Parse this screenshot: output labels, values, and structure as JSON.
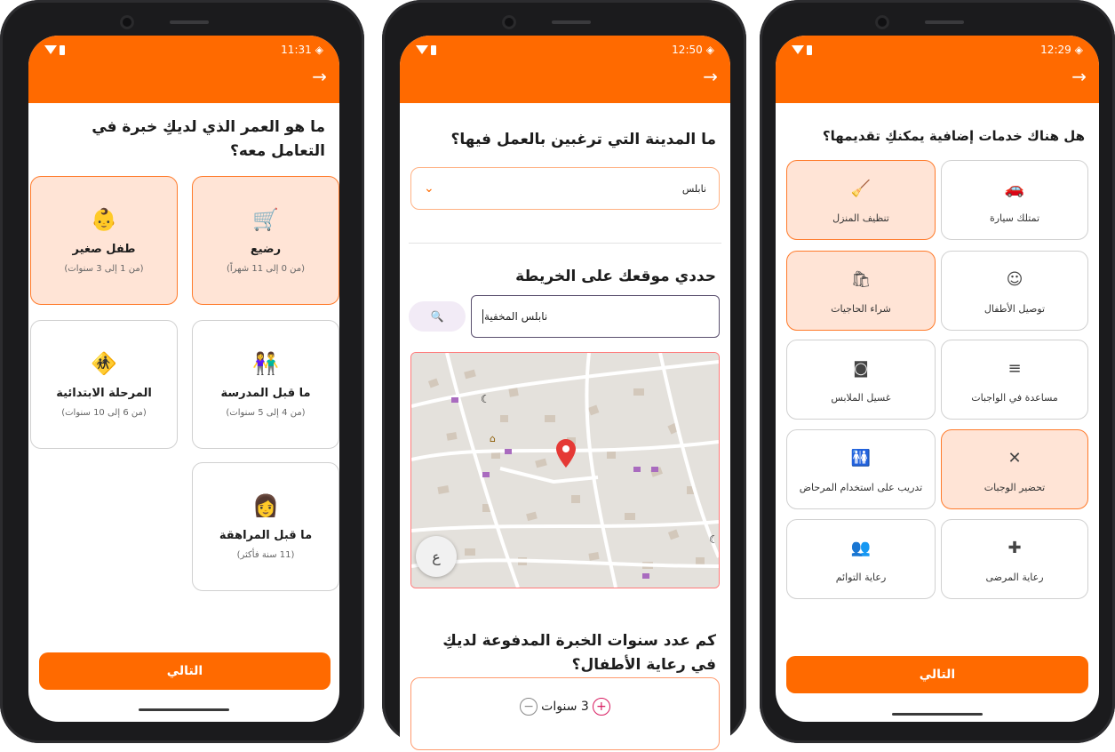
{
  "phone1": {
    "status": {
      "time": "11:31"
    },
    "question": "ما هو العمر الذي لديكِ خبرة في التعامل معه؟",
    "cards": [
      {
        "name": "رضيع",
        "sub": "(من 0 إلى 11 شهراً)",
        "icon": "baby-stroller-icon",
        "selected": true
      },
      {
        "name": "طفل صغير",
        "sub": "(من 1 إلى 3 سنوات)",
        "icon": "crawling-baby-icon",
        "selected": true
      },
      {
        "name": "ما قبل المدرسة",
        "sub": "(من 4 إلى 5 سنوات)",
        "icon": "kids-icon",
        "selected": false
      },
      {
        "name": "المرحلة الابتدائية",
        "sub": "(من 6 إلى 10 سنوات)",
        "icon": "school-kids-icon",
        "selected": false
      },
      {
        "name": "ما قبل المراهقة",
        "sub": "(11 سنة فأكثر)",
        "icon": "teen-icon",
        "selected": false
      }
    ],
    "next_label": "التالي"
  },
  "phone2": {
    "status": {
      "time": "12:50"
    },
    "city_question": "ما المدينة التي ترغبين بالعمل فيها؟",
    "city_value": "نابلس",
    "map_question": "حددي موقعك على الخريطة",
    "search_value": "نابلس المخفية",
    "zoom_label": "ع",
    "years_question": "كم عدد سنوات الخبرة المدفوعة لديكِ في رعاية الأطفال؟",
    "years_value": "3 سنوات"
  },
  "phone3": {
    "status": {
      "time": "12:29"
    },
    "question": "هل هناك خدمات إضافية يمكنكِ تقديمها؟",
    "services": [
      {
        "name": "تمتلك سيارة",
        "icon": "car-icon",
        "selected": false
      },
      {
        "name": "تنظيف المنزل",
        "icon": "broom-icon",
        "selected": true
      },
      {
        "name": "توصيل الأطفال",
        "icon": "child-face-icon",
        "selected": false
      },
      {
        "name": "شراء الحاجيات",
        "icon": "shopping-bag-icon",
        "selected": true
      },
      {
        "name": "مساعدة في الواجبات",
        "icon": "homework-icon",
        "selected": false
      },
      {
        "name": "غسيل الملابس",
        "icon": "washing-machine-icon",
        "selected": false
      },
      {
        "name": "تحضير الوجبات",
        "icon": "utensils-icon",
        "selected": true
      },
      {
        "name": "تدريب على استخدام المرحاض",
        "icon": "restroom-icon",
        "selected": false
      },
      {
        "name": "رعاية المرضى",
        "icon": "bandage-icon",
        "selected": false
      },
      {
        "name": "رعاية التوائم",
        "icon": "twins-icon",
        "selected": false
      }
    ],
    "next_label": "التالي"
  }
}
